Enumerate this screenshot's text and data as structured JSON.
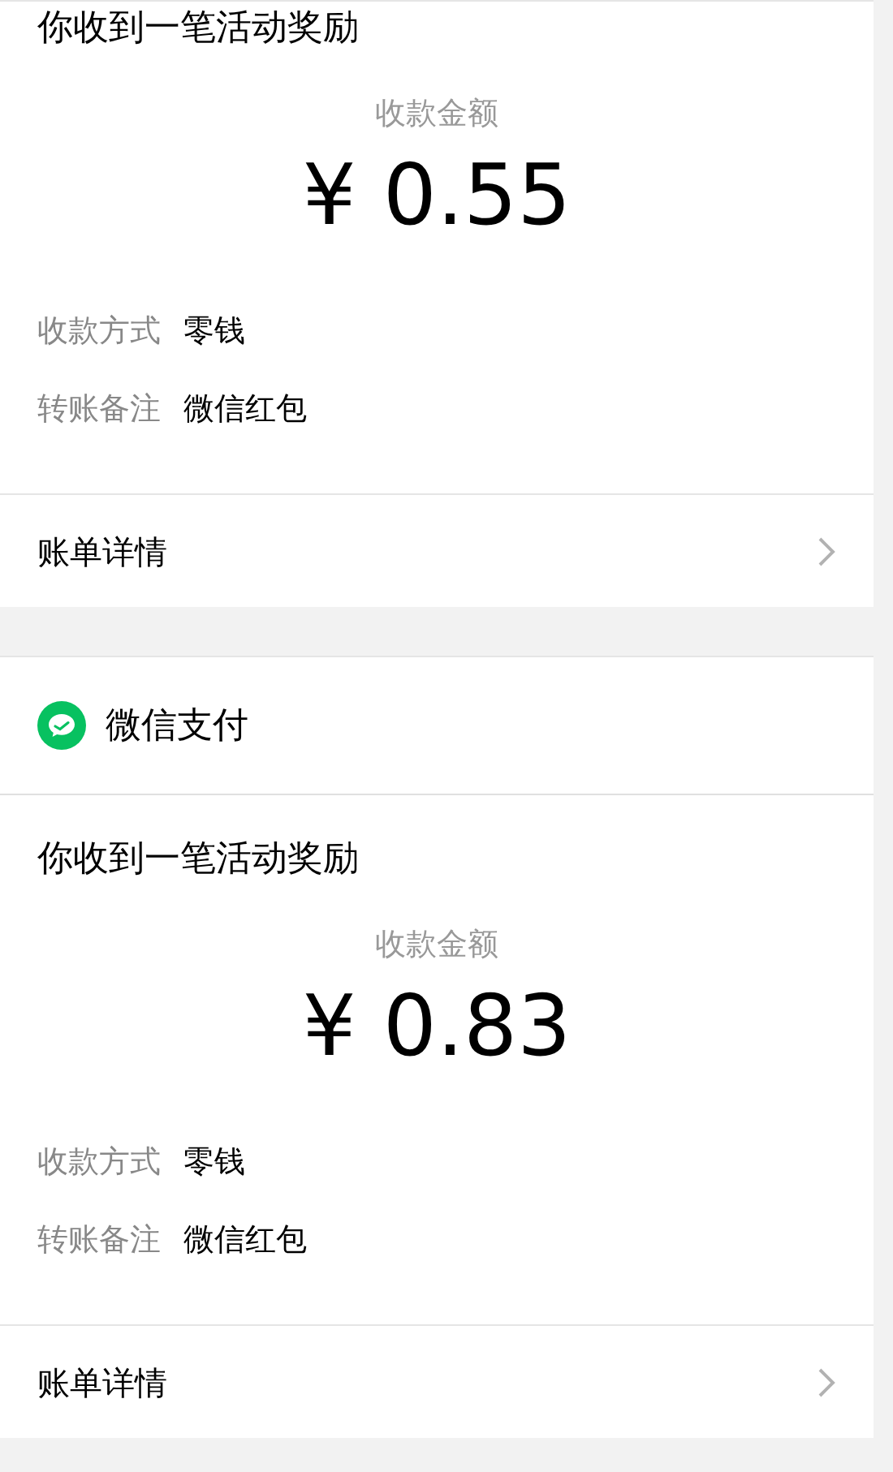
{
  "cards": [
    {
      "title": "你收到一笔活动奖励",
      "amount_label": "收款金额",
      "amount": "¥ 0.55",
      "rows": [
        {
          "label": "收款方式",
          "value": "零钱"
        },
        {
          "label": "转账备注",
          "value": "微信红包"
        }
      ],
      "link": "账单详情"
    },
    {
      "header": "微信支付",
      "title": "你收到一笔活动奖励",
      "amount_label": "收款金额",
      "amount": "¥ 0.83",
      "rows": [
        {
          "label": "收款方式",
          "value": "零钱"
        },
        {
          "label": "转账备注",
          "value": "微信红包"
        }
      ],
      "link": "账单详情"
    }
  ]
}
